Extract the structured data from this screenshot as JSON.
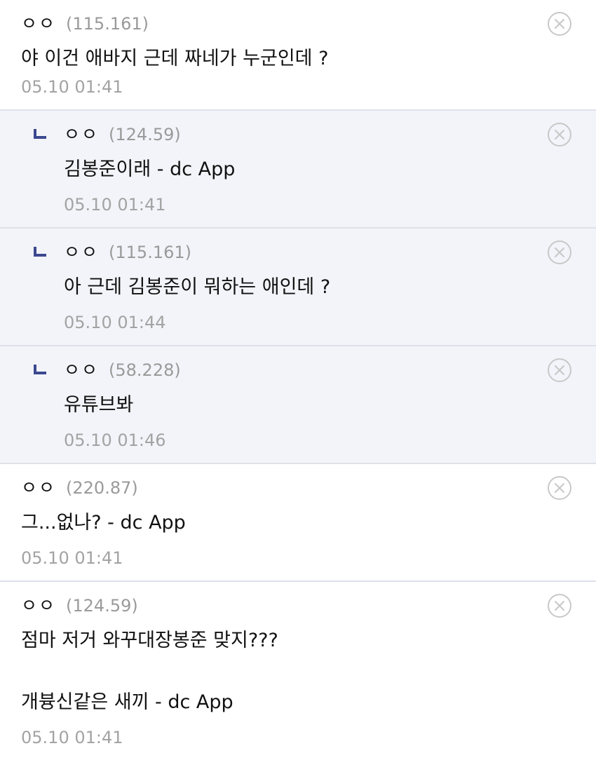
{
  "comments": [
    {
      "nick": "ㅇㅇ",
      "ip": "(115.161)",
      "body": "야 이건 애바지 근데 짜네가 누군인데 ?",
      "date": "05.10 01:41"
    },
    {
      "nick": "ㅇㅇ",
      "ip": "(124.59)",
      "body": "김봉준이래 - dc App",
      "date": "05.10 01:41"
    },
    {
      "nick": "ㅇㅇ",
      "ip": "(115.161)",
      "body": "아 근데 김봉준이 뭐하는 애인데 ?",
      "date": "05.10 01:44"
    },
    {
      "nick": "ㅇㅇ",
      "ip": "(58.228)",
      "body": "유튜브봐",
      "date": "05.10 01:46"
    },
    {
      "nick": "ㅇㅇ",
      "ip": "(220.87)",
      "body": "그...없나? - dc App",
      "date": "05.10 01:41"
    },
    {
      "nick": "ㅇㅇ",
      "ip": "(124.59)",
      "body": "점마 저거 와꾸대장봉준 맞지???\n\n개븅신같은 새끼 - dc App",
      "date": "05.10 01:41"
    }
  ],
  "icons": {
    "delete": "close-circle-icon",
    "reply": "reply-arrow-icon"
  },
  "colors": {
    "reply_background": "#f3f4f9",
    "reply_marker": "#3b4890",
    "divider": "#dfe1ea",
    "meta_text": "#a3a3a3"
  }
}
